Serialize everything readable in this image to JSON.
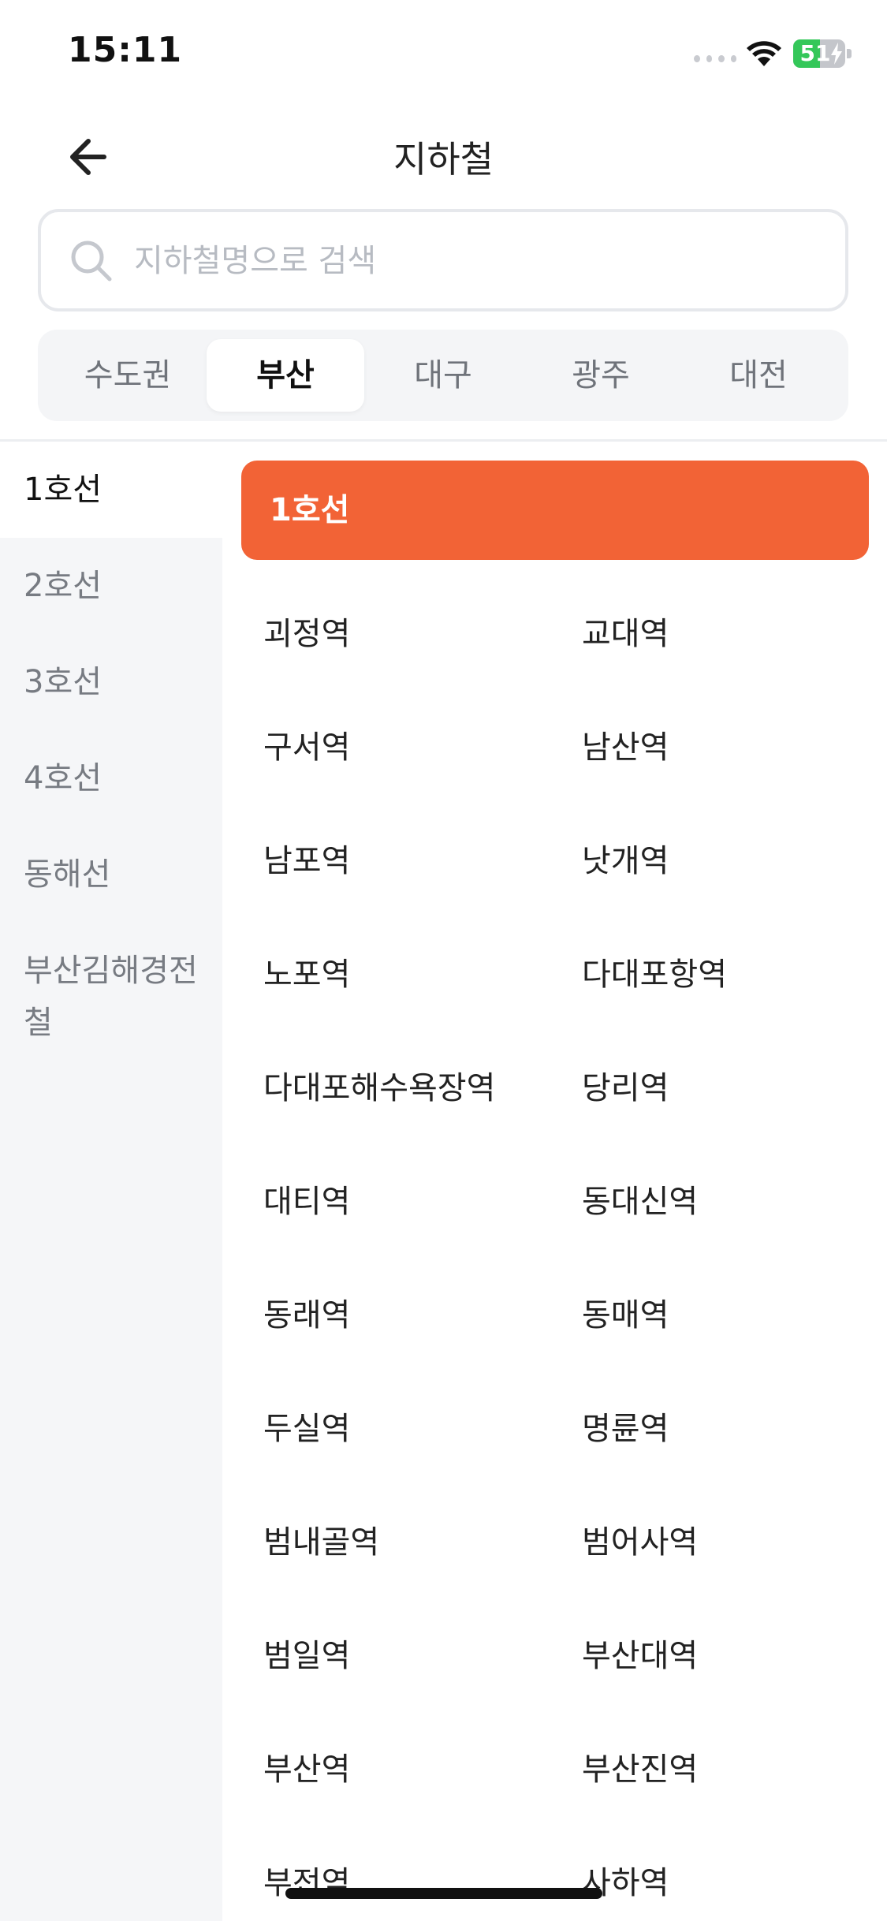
{
  "status_bar": {
    "time": "15:11",
    "battery": "51",
    "battery_level": 0.51
  },
  "header": {
    "title": "지하철"
  },
  "search": {
    "placeholder": "지하철명으로 검색",
    "value": ""
  },
  "region_tabs": [
    "수도권",
    "부산",
    "대구",
    "광주",
    "대전"
  ],
  "active_region": "부산",
  "lines": [
    "1호선",
    "2호선",
    "3호선",
    "4호선",
    "동해선",
    "부산김해경전철"
  ],
  "active_line": "1호선",
  "selected_line_label": "1호선",
  "stations": [
    "괴정역",
    "교대역",
    "구서역",
    "남산역",
    "남포역",
    "낫개역",
    "노포역",
    "다대포항역",
    "다대포해수욕장역",
    "당리역",
    "대티역",
    "동대신역",
    "동래역",
    "동매역",
    "두실역",
    "명륜역",
    "범내골역",
    "범어사역",
    "범일역",
    "부산대역",
    "부산역",
    "부산진역",
    "부전역",
    "사하역"
  ],
  "colors": {
    "accent": "#f26336",
    "battery": "#34c759"
  }
}
